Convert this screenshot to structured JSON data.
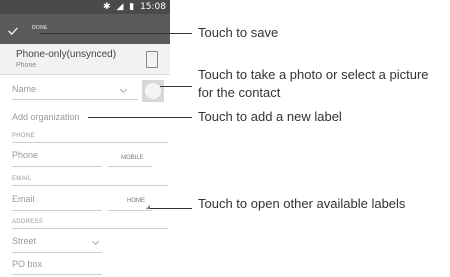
{
  "status_bar": {
    "time": "15:08"
  },
  "action_bar": {
    "done_label": "DONE"
  },
  "account": {
    "name": "Phone-only(unsynced)",
    "type": "Phone"
  },
  "form": {
    "name_placeholder": "Name",
    "add_organization": "Add organization",
    "phone_section": "PHONE",
    "phone_placeholder": "Phone",
    "phone_label": "MOBILE",
    "email_section": "EMAIL",
    "email_placeholder": "Email",
    "email_label": "HOME",
    "address_section": "ADDRESS",
    "street_placeholder": "Street",
    "pobox_placeholder": "PO box"
  },
  "callouts": {
    "save": "Touch to save",
    "photo_line1": "Touch to take a photo or select a picture",
    "photo_line2": "for the contact",
    "add_label": "Touch to add a new label",
    "other_labels": "Touch to open other available labels"
  }
}
